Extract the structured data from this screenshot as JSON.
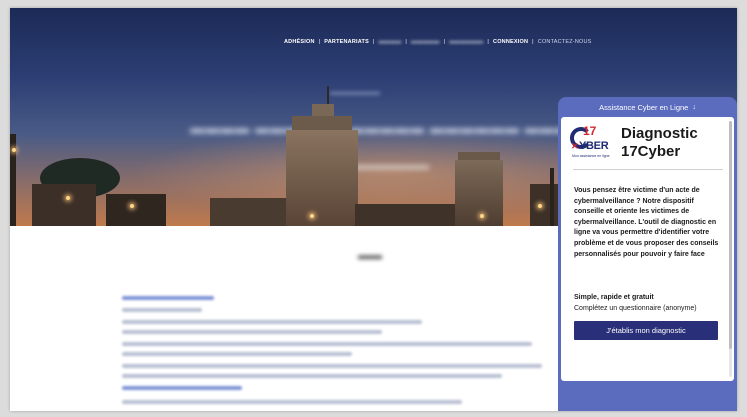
{
  "nav": {
    "items": [
      {
        "label": "ADHÉSION",
        "blurred": false
      },
      {
        "label": "PARTENARIATS",
        "blurred": false
      },
      {
        "label": "",
        "blurred": true
      },
      {
        "label": "",
        "blurred": true
      },
      {
        "label": "",
        "blurred": true
      },
      {
        "label": "CONNEXION",
        "blurred": false
      },
      {
        "label": "CONTACTEZ-NOUS",
        "blurred": false
      }
    ]
  },
  "chat": {
    "header": "Assistance Cyber en Ligne",
    "header_icon": "arrow-down-icon",
    "logo": {
      "number": "17",
      "word": "YBER",
      "tagline": "Mon assistance en ligne"
    },
    "title": "Diagnostic 17Cyber",
    "description": "Vous pensez être victime d'un acte de cybermalveillance ? Notre dispositif conseille et oriente les victimes de cybermalveillance. L'outil de diagnostic en ligne va vous permettre d'identifier votre problème et de vous proposer des conseils personnalisés pour pouvoir y faire face",
    "lead": "Simple, rapide et gratuit",
    "note": "Complétez un questionnaire (anonyme)",
    "cta": "J'établis mon diagnostic"
  },
  "colors": {
    "panel": "#5b6bbd",
    "cta": "#2a2f79",
    "logo_blue": "#1f2b73",
    "logo_red": "#d2292f"
  }
}
